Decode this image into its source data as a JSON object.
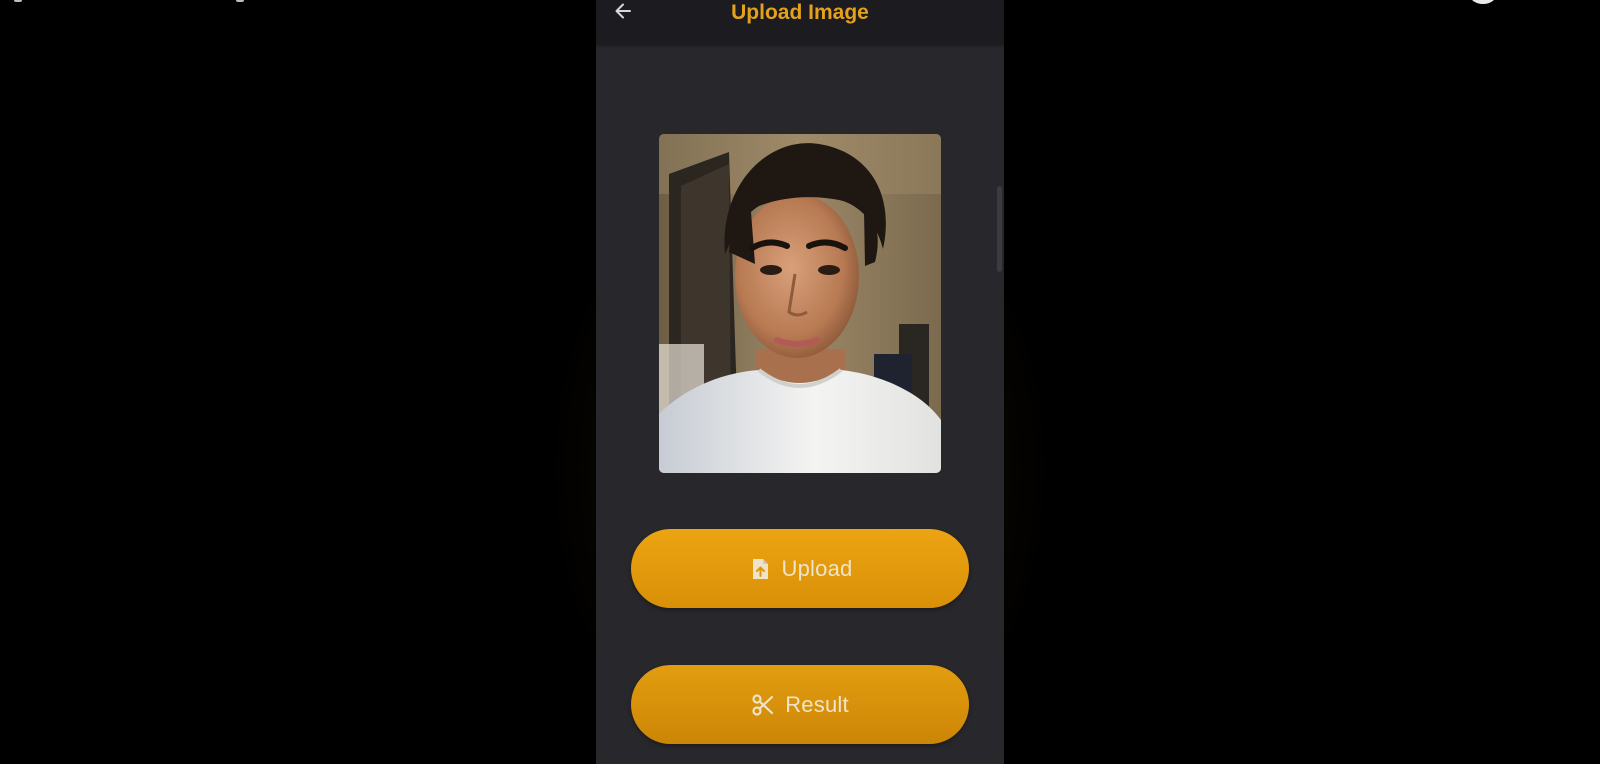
{
  "app_bar": {
    "title": "Upload Image",
    "back_icon": "arrow-left-icon"
  },
  "preview": {
    "alt": "selected photo preview"
  },
  "buttons": {
    "upload": {
      "label": "Upload",
      "icon": "file-upload-icon"
    },
    "result": {
      "label": "Result",
      "icon": "scissors-icon"
    }
  },
  "colors": {
    "accent": "#e3a11c",
    "button": "#e69d0f",
    "surface": "#28272b",
    "app_bar": "#1c1b1f",
    "button_text": "#efe3c9"
  }
}
